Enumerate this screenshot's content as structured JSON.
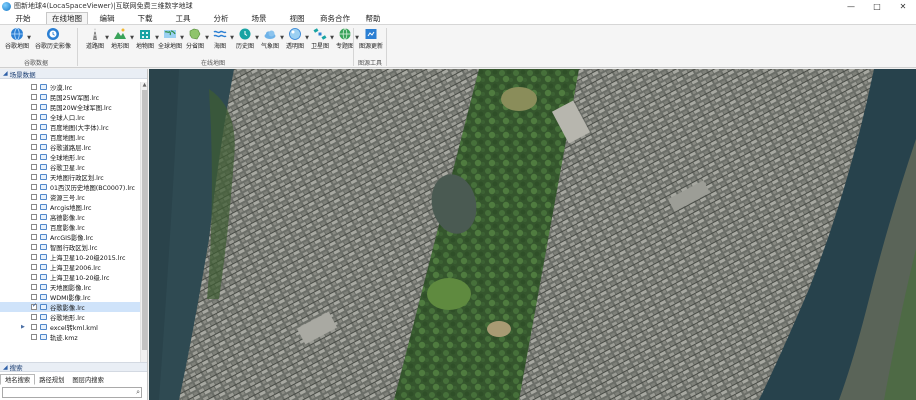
{
  "window": {
    "title": "图新地球4(LocaSpaceViewer)|互联网免费三维数字地球",
    "controls": {
      "minimize": "—",
      "maximize": "□",
      "close": "✕"
    }
  },
  "menu": {
    "tabs": [
      "开始",
      "在线地图",
      "编辑",
      "下载",
      "工具",
      "分析",
      "场景",
      "视图",
      "商务合作",
      "帮助"
    ],
    "active_index": 1
  },
  "ribbon": {
    "groups": [
      {
        "label": "谷歌数据",
        "buttons": [
          {
            "label": "谷歌地图",
            "icon": "globe-icon",
            "dropdown": true
          },
          {
            "label": "谷歌历史影像",
            "icon": "history-globe-icon",
            "dropdown": false
          }
        ]
      },
      {
        "label": "在线地图",
        "buttons": [
          {
            "label": "道路图",
            "icon": "road-icon",
            "dropdown": true
          },
          {
            "label": "地形图",
            "icon": "terrain-icon",
            "dropdown": true
          },
          {
            "label": "地物图",
            "icon": "landmark-icon",
            "dropdown": true
          },
          {
            "label": "全球地图",
            "icon": "world-map-icon",
            "dropdown": true
          },
          {
            "label": "分省图",
            "icon": "province-map-icon",
            "dropdown": true
          },
          {
            "label": "海图",
            "icon": "sea-chart-icon",
            "dropdown": true
          },
          {
            "label": "历史图",
            "icon": "history-map-icon",
            "dropdown": true
          },
          {
            "label": "气象图",
            "icon": "weather-icon",
            "dropdown": true
          },
          {
            "label": "透明图",
            "icon": "transparent-map-icon",
            "dropdown": true
          },
          {
            "label": "卫星图",
            "icon": "satellite-icon",
            "dropdown": true
          },
          {
            "label": "专题图",
            "icon": "thematic-map-icon",
            "dropdown": true
          }
        ]
      },
      {
        "label": "图源工具",
        "buttons": [
          {
            "label": "图源更新",
            "icon": "source-update-icon",
            "dropdown": false
          }
        ]
      }
    ],
    "colors": {
      "accent": "#2b7fd3",
      "teal": "#17a3a3",
      "green": "#3aa35a"
    }
  },
  "scene_panel": {
    "title": "场景数据",
    "items": [
      {
        "label": "沙漠.lrc",
        "checked": false,
        "selected": false,
        "expandable": false
      },
      {
        "label": "民国25W军图.lrc",
        "checked": false,
        "selected": false,
        "expandable": false
      },
      {
        "label": "民国20W全球军图.lrc",
        "checked": false,
        "selected": false,
        "expandable": false
      },
      {
        "label": "全球人口.lrc",
        "checked": false,
        "selected": false,
        "expandable": false
      },
      {
        "label": "百度地图(大字体).lrc",
        "checked": false,
        "selected": false,
        "expandable": false
      },
      {
        "label": "百度地图.lrc",
        "checked": false,
        "selected": false,
        "expandable": false
      },
      {
        "label": "谷歌道路层.lrc",
        "checked": false,
        "selected": false,
        "expandable": false
      },
      {
        "label": "全球地形.lrc",
        "checked": false,
        "selected": false,
        "expandable": false
      },
      {
        "label": "谷歌卫星.lrc",
        "checked": false,
        "selected": false,
        "expandable": false
      },
      {
        "label": "天地图行政区划.lrc",
        "checked": false,
        "selected": false,
        "expandable": false
      },
      {
        "label": "01西汉历史地图(BC0007).lrc",
        "checked": false,
        "selected": false,
        "expandable": false
      },
      {
        "label": "资源三号.lrc",
        "checked": false,
        "selected": false,
        "expandable": false
      },
      {
        "label": "Arcgis地图.lrc",
        "checked": false,
        "selected": false,
        "expandable": false
      },
      {
        "label": "高德影像.lrc",
        "checked": false,
        "selected": false,
        "expandable": false
      },
      {
        "label": "百度影像.lrc",
        "checked": false,
        "selected": false,
        "expandable": false
      },
      {
        "label": "ArcGIS影像.lrc",
        "checked": false,
        "selected": false,
        "expandable": false
      },
      {
        "label": "智图行政区划.lrc",
        "checked": false,
        "selected": false,
        "expandable": false
      },
      {
        "label": "上海卫星10-20级2015.lrc",
        "checked": false,
        "selected": false,
        "expandable": false
      },
      {
        "label": "上海卫星2006.lrc",
        "checked": false,
        "selected": false,
        "expandable": false
      },
      {
        "label": "上海卫星10-20级.lrc",
        "checked": false,
        "selected": false,
        "expandable": false
      },
      {
        "label": "天地图影像.lrc",
        "checked": false,
        "selected": false,
        "expandable": false
      },
      {
        "label": "WDMI影像.lrc",
        "checked": false,
        "selected": false,
        "expandable": false
      },
      {
        "label": "谷歌影像.lrc",
        "checked": true,
        "selected": true,
        "expandable": false
      },
      {
        "label": "谷歌地形.lrc",
        "checked": false,
        "selected": false,
        "expandable": false
      },
      {
        "label": "excel转kml.kml",
        "checked": false,
        "selected": false,
        "expandable": true
      },
      {
        "label": "轨迹.kmz",
        "checked": false,
        "selected": false,
        "expandable": false
      }
    ]
  },
  "search_panel": {
    "title": "搜索",
    "tabs": [
      "地名搜索",
      "路径规划",
      "图层内搜索"
    ],
    "active_index": 0,
    "input_value": "",
    "search_icon": "search-icon"
  }
}
